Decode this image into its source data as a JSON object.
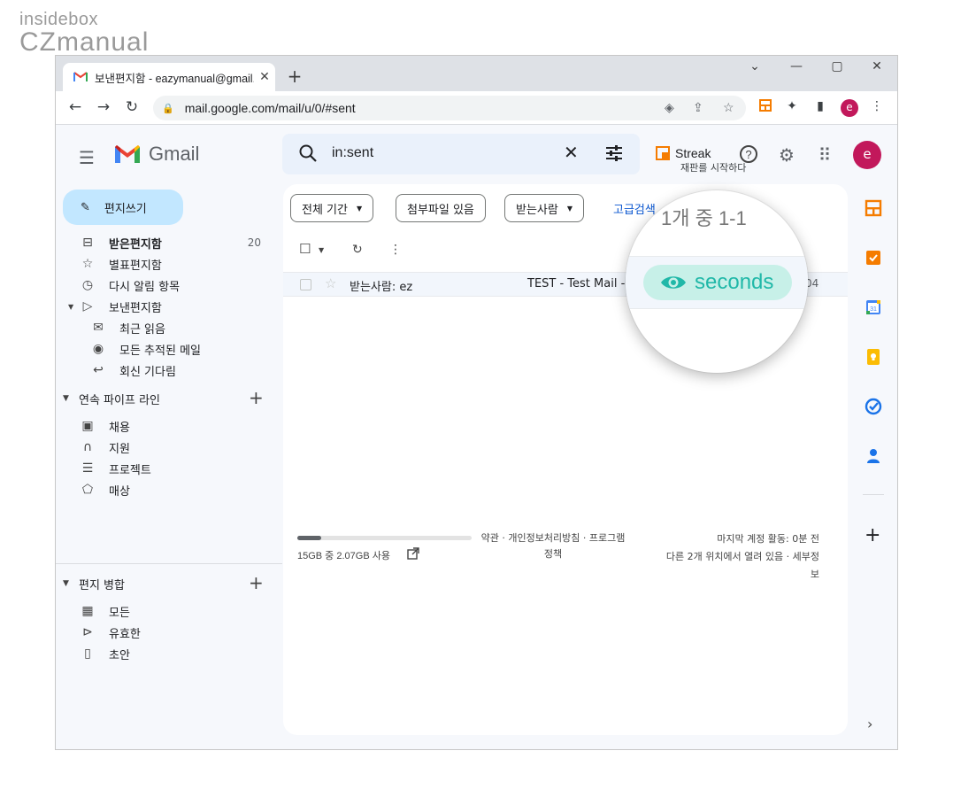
{
  "watermark": {
    "line1": "insidebox",
    "line2": "CZmanual"
  },
  "browser": {
    "tab_title": "보낸편지함 - eazymanual@gmail.com",
    "url": "mail.google.com/mail/u/0/#sent",
    "profile_initial": "e"
  },
  "gmail": {
    "logo_text": "Gmail",
    "search_value": "in:sent",
    "streak_label": "Streak",
    "streak_sub": "재판를 시작하다",
    "avatar_initial": "e",
    "compose_label": "편지쓰기",
    "nav": [
      {
        "label": "받은편지함",
        "count": "20",
        "icon": "inbox-icon"
      },
      {
        "label": "별표편지함",
        "icon": "star-icon"
      },
      {
        "label": "다시 알림 항목",
        "icon": "clock-icon"
      },
      {
        "label": "보낸편지함",
        "icon": "send-icon"
      },
      {
        "label": "최근 읽음",
        "icon": "envelope-open-icon"
      },
      {
        "label": "모든 추적된 메일",
        "icon": "eye-icon"
      },
      {
        "label": "회신 기다림",
        "icon": "reply-icon"
      }
    ],
    "pipeline_section": "연속 파이프 라인",
    "pipelines": [
      "채용",
      "지원",
      "프로젝트",
      "매상"
    ],
    "merge_section": "편지 병합",
    "merges": [
      "모든",
      "유효한",
      "초안"
    ]
  },
  "filters": {
    "period": "전체 기간",
    "attachment": "첨부파일 있음",
    "recipient": "받는사람",
    "advanced": "고급검색"
  },
  "mail_row": {
    "to": "받는사람: ez",
    "subject": "TEST - Test Mail -",
    "date": "04"
  },
  "footer": {
    "storage_text": "15GB 중 2.07GB 사용",
    "storage_fraction": 0.138,
    "links_line1": "약관 · 개인정보처리방침 · 프로그램",
    "links_line2": "정책",
    "activity_line1": "마지막 계정 활동: 0분 전",
    "activity_line2": "다른 2개 위치에서 열려 있음 · 세부정",
    "activity_line3": "보"
  },
  "magnifier": {
    "count_text": "1개 중 1-1",
    "pill_text": "seconds"
  },
  "colors": {
    "accent_blue": "#0b57d0",
    "compose_bg": "#c2e7ff",
    "streak_orange": "#f57c00",
    "avatar": "#c2185b",
    "seconds_teal": "#20b8a8"
  }
}
